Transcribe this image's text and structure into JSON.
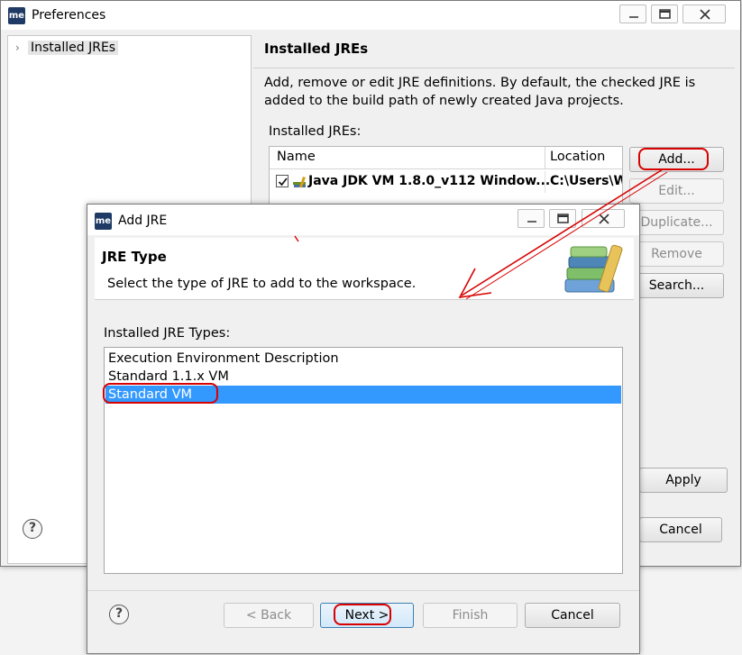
{
  "preferences": {
    "title": "Preferences",
    "app_icon": "me",
    "nav": {
      "items": [
        {
          "label": "Installed JREs"
        }
      ]
    },
    "page": {
      "title": "Installed JREs",
      "description": "Add, remove or edit JRE definitions. By default, the checked JRE is added to the build path of newly created Java projects.",
      "table_label": "Installed JREs:",
      "columns": [
        "Name",
        "Location"
      ],
      "rows": [
        {
          "checked": true,
          "name": "Java JDK VM 1.8.0_v112 Window...",
          "location": "C:\\Users\\W"
        }
      ]
    },
    "buttons": {
      "add": "Add...",
      "edit": "Edit...",
      "duplicate": "Duplicate...",
      "remove": "Remove",
      "search": "Search...",
      "apply": "Apply",
      "cancel": "Cancel"
    },
    "help": "?"
  },
  "add_jre": {
    "title": "Add JRE",
    "app_icon": "me",
    "banner": {
      "title": "JRE Type",
      "message": "Select the type of JRE to add to the workspace."
    },
    "types_label": "Installed JRE Types:",
    "types": [
      {
        "label": "Execution Environment Description",
        "selected": false
      },
      {
        "label": "Standard 1.1.x VM",
        "selected": false
      },
      {
        "label": "Standard VM",
        "selected": true
      }
    ],
    "buttons": {
      "back": "< Back",
      "next": "Next >",
      "finish": "Finish",
      "cancel": "Cancel"
    },
    "help": "?"
  },
  "colors": {
    "selection": "#3399ff",
    "annotation": "#d80000",
    "window_bg": "#f0f0f0"
  },
  "icons": [
    "app-logo-icon",
    "minimize-icon",
    "maximize-icon",
    "close-icon",
    "chevron-right-icon",
    "checkbox-icon",
    "jre-library-icon",
    "books-icon",
    "help-icon"
  ]
}
